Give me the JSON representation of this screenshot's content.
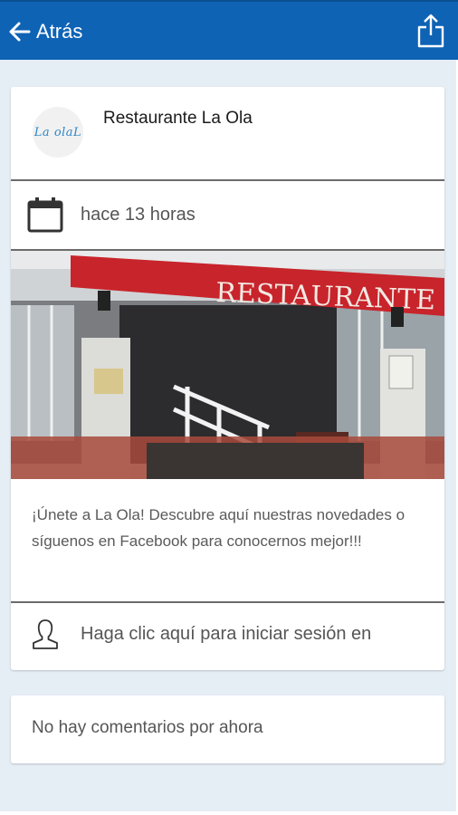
{
  "header": {
    "back_label": "Atrás",
    "back_icon": "arrow-left-icon",
    "share_icon": "share-icon"
  },
  "post": {
    "author": "Restaurante La Ola",
    "avatar_logo_text": "La olaL",
    "date_icon": "calendar-icon",
    "date": "hace 13 horas",
    "image_sign_text": "RESTAURANTE",
    "text": "¡Únete a La Ola! Descubre aquí nuestras novedades o síguenos en Facebook para conocernos mejor!!!",
    "login_icon": "user-icon",
    "login_prompt": "Haga clic aquí para iniciar sesión en"
  },
  "comments": {
    "empty_text": "No hay comentarios por ahora"
  },
  "colors": {
    "header_bg": "#0e63b5",
    "page_bg": "#e5edf5",
    "awning_red": "#c8242b"
  }
}
